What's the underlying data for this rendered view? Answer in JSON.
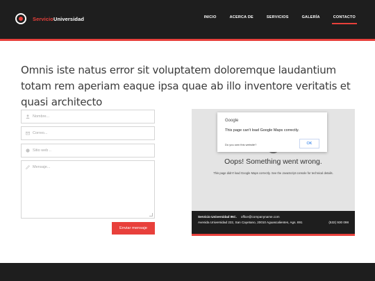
{
  "header": {
    "logo_part1": "Servicio",
    "logo_part2": "Universidad",
    "nav": [
      {
        "label": "INICIO"
      },
      {
        "label": "ACERCA DE"
      },
      {
        "label": "SERVICIOS"
      },
      {
        "label": "GALERÍA"
      },
      {
        "label": "CONTACTO",
        "active": true
      }
    ]
  },
  "intro": "Omnis iste natus error sit voluptatem doloremque laudantium totam rem aperiam eaque ipsa quae ab illo inventore veritatis et quasi architecto",
  "form": {
    "name_placeholder": "Nombre...",
    "email_placeholder": "Correo...",
    "website_placeholder": "Sitio web ..",
    "message_placeholder": "Mensaje...",
    "submit_label": "Enviar mensaje"
  },
  "map": {
    "dialog_title": "Google",
    "dialog_text": "This page can't load Google Maps correctly.",
    "dialog_own": "Do you own this website?",
    "dialog_ok": "OK",
    "oops": "Oops! Something went wrong.",
    "oops_sub": "This page didn't load Google Maps correctly. See the JavaScript console for technical details."
  },
  "map_footer": {
    "company": "Servicio Universidad INC.",
    "email": "office@companyname.com",
    "address": "Avenida Universidad 222, San Cayetano, 20010 Aguascalientes, Ags. 891",
    "phone": "(532) 930 098"
  },
  "colors": {
    "accent": "#e8403b",
    "dark": "#1e1e1e"
  }
}
